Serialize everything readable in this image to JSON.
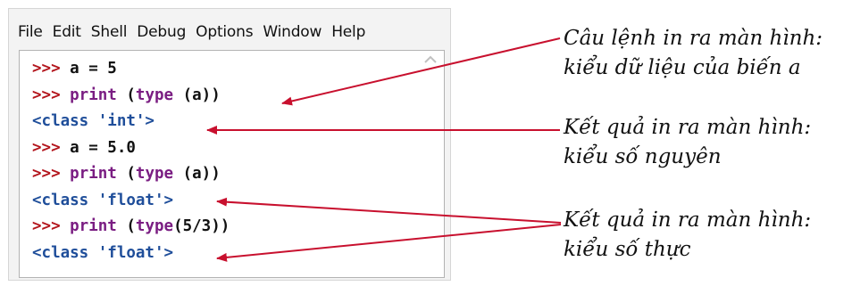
{
  "menu": [
    "File",
    "Edit",
    "Shell",
    "Debug",
    "Options",
    "Window",
    "Help"
  ],
  "code_lines": [
    {
      "prompt": ">>>",
      "parts": [
        {
          "cls": "t",
          "text": " a = 5"
        }
      ]
    },
    {
      "prompt": ">>>",
      "parts": [
        {
          "cls": "k",
          "text": " print"
        },
        {
          "cls": "t",
          "text": " ("
        },
        {
          "cls": "k",
          "text": "type"
        },
        {
          "cls": "t",
          "text": " (a))"
        }
      ]
    },
    {
      "prompt": "",
      "parts": [
        {
          "cls": "o",
          "text": "<class 'int'>"
        }
      ]
    },
    {
      "prompt": ">>>",
      "parts": [
        {
          "cls": "t",
          "text": " a = 5.0"
        }
      ]
    },
    {
      "prompt": ">>>",
      "parts": [
        {
          "cls": "k",
          "text": " print"
        },
        {
          "cls": "t",
          "text": " ("
        },
        {
          "cls": "k",
          "text": "type"
        },
        {
          "cls": "t",
          "text": " (a))"
        }
      ]
    },
    {
      "prompt": "",
      "parts": [
        {
          "cls": "o",
          "text": "<class 'float'>"
        }
      ]
    },
    {
      "prompt": ">>>",
      "parts": [
        {
          "cls": "k",
          "text": " print"
        },
        {
          "cls": "t",
          "text": " ("
        },
        {
          "cls": "k",
          "text": "type"
        },
        {
          "cls": "t",
          "text": "(5/3))"
        }
      ]
    },
    {
      "prompt": "",
      "parts": [
        {
          "cls": "o",
          "text": "<class 'float'>"
        }
      ]
    }
  ],
  "annotations": {
    "a1": {
      "line1": "Câu lệnh in ra màn hình:",
      "line2": "kiểu dữ liệu của biến a"
    },
    "a2": {
      "line1": "Kết quả in ra màn hình:",
      "line2": "kiểu số nguyên"
    },
    "a3": {
      "line1": "Kết quả in ra màn hình:",
      "line2": "kiểu số thực"
    }
  },
  "colors": {
    "prompt": "#b3151c",
    "keyword": "#7a1d82",
    "output": "#1f4e9a",
    "text": "#111111",
    "arrow": "#c8102e"
  },
  "icons": {
    "scroll_up": "chevron-up-icon"
  }
}
